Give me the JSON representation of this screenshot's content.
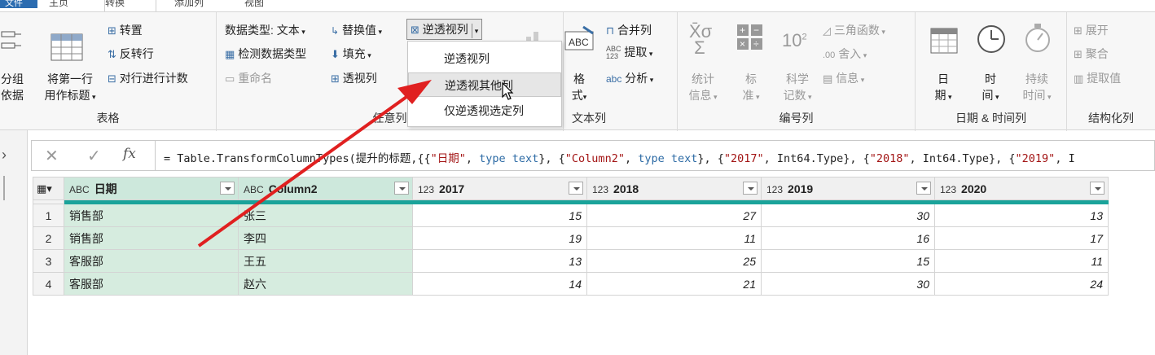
{
  "tabs": {
    "file": "文件",
    "items": [
      {
        "label": "主页"
      },
      {
        "label": "转换"
      },
      {
        "label": "添加列"
      },
      {
        "label": "视图"
      }
    ]
  },
  "ribbon": {
    "table_group": {
      "label": "表格",
      "group_by": "分组依据",
      "group_by_1": "分组",
      "group_by_2": "依据",
      "first_row_1": "将第一行",
      "first_row_2": "用作标题",
      "transpose": "转置",
      "reverse_rows": "反转行",
      "count_rows": "对行进行计数"
    },
    "any_column_group": {
      "label": "任意列",
      "data_type": "数据类型: 文本",
      "detect_type": "检测数据类型",
      "rename": "重命名",
      "replace_values": "替换值",
      "fill": "填充",
      "pivot": "透视列",
      "unpivot": "逆透视列"
    },
    "text_column_group": {
      "label": "文本列",
      "format": "格式",
      "format_1": "格",
      "format_2": "式",
      "merge": "合并列",
      "extract": "提取",
      "parse": "分析",
      "abc_top": "ABC",
      "abc_bottom": "123"
    },
    "number_column_group": {
      "label": "编号列",
      "statistics_1": "统计",
      "statistics_2": "信息",
      "standard_1": "标",
      "standard_2": "准",
      "scientific_1": "科学",
      "scientific_2": "记数",
      "trig": "三角函数",
      "rounding": "舍入",
      "information": "信息",
      "ten": "10",
      "sup": "2"
    },
    "datetime_group": {
      "label": "日期 & 时间列",
      "date_1": "日",
      "date_2": "期",
      "time_1": "时",
      "time_2": "间",
      "duration_1": "持续",
      "duration_2": "时间"
    },
    "structured_group": {
      "label": "结构化列",
      "expand": "展开",
      "aggregate": "聚合",
      "extract_values": "提取值"
    }
  },
  "unpivot_menu": {
    "items": [
      {
        "label": "逆透视列"
      },
      {
        "label": "逆透视其他列"
      },
      {
        "label": "仅逆透视选定列"
      }
    ]
  },
  "formula_bar": {
    "fx": "fx",
    "parts": {
      "p1": "= Table.TransformColumnTypes(提升的标题,{{",
      "s1": "\"日期\"",
      "p2": ", ",
      "k1": "type text",
      "p3": "}, {",
      "s2": "\"Column2\"",
      "p4": ", ",
      "k2": "type text",
      "p5": "}, {",
      "s3": "\"2017\"",
      "p6": ", Int64.Type}, {",
      "s4": "\"2018\"",
      "p7": ", Int64.Type}, {",
      "s5": "\"2019\"",
      "p8": ", I"
    }
  },
  "grid": {
    "columns": [
      {
        "type": "ABC",
        "name": "日期"
      },
      {
        "type": "ABC",
        "name": "Column2"
      },
      {
        "type": "123",
        "name": "2017"
      },
      {
        "type": "123",
        "name": "2018"
      },
      {
        "type": "123",
        "name": "2019"
      },
      {
        "type": "123",
        "name": "2020"
      }
    ],
    "rows": [
      {
        "n": "1",
        "dept": "销售部",
        "name": "张三",
        "y2017": "15",
        "y2018": "27",
        "y2019": "30",
        "y2020": "13"
      },
      {
        "n": "2",
        "dept": "销售部",
        "name": "李四",
        "y2017": "19",
        "y2018": "11",
        "y2019": "16",
        "y2020": "17"
      },
      {
        "n": "3",
        "dept": "客服部",
        "name": "王五",
        "y2017": "13",
        "y2018": "25",
        "y2019": "15",
        "y2020": "11"
      },
      {
        "n": "4",
        "dept": "客服部",
        "name": "赵六",
        "y2017": "14",
        "y2018": "21",
        "y2019": "30",
        "y2020": "24"
      }
    ]
  },
  "colors": {
    "accent_teal": "#1aa39a",
    "selected_col": "#cde8dc",
    "annotation_arrow": "#e02020",
    "file_tab": "#2b6cb0"
  }
}
